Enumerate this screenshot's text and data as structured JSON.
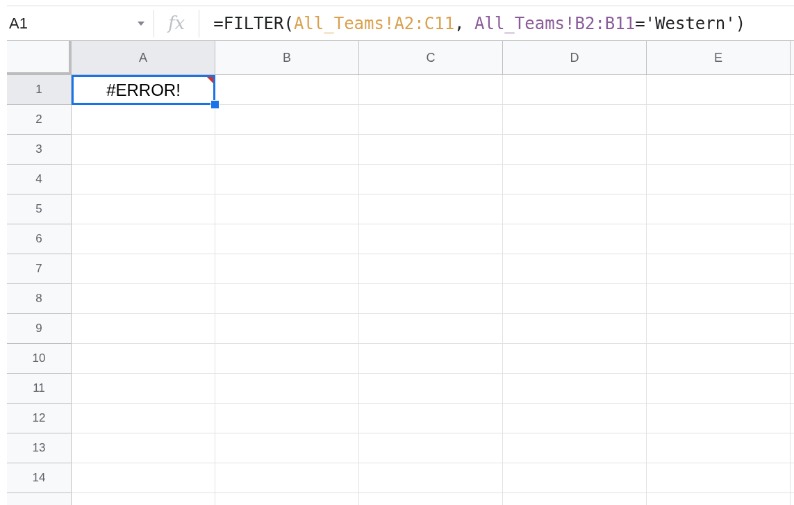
{
  "name_box": "A1",
  "formula_bar": {
    "icon_label": "fx",
    "parts": [
      {
        "text": "=FILTER(",
        "color": "#202124"
      },
      {
        "text": "All_Teams!A2:C11",
        "color": "#d9a14e"
      },
      {
        "text": ", ",
        "color": "#202124"
      },
      {
        "text": "All_Teams!B2:B11",
        "color": "#8a5b9a"
      },
      {
        "text": "='Western')",
        "color": "#202124"
      }
    ]
  },
  "columns": [
    {
      "label": "A",
      "selected": true
    },
    {
      "label": "B",
      "selected": false
    },
    {
      "label": "C",
      "selected": false
    },
    {
      "label": "D",
      "selected": false
    },
    {
      "label": "E",
      "selected": false
    }
  ],
  "rows": [
    {
      "label": "1",
      "selected": true,
      "cells": [
        {
          "text": "#ERROR!",
          "selected": true,
          "error": true
        }
      ]
    },
    {
      "label": "2",
      "selected": false
    },
    {
      "label": "3",
      "selected": false
    },
    {
      "label": "4",
      "selected": false
    },
    {
      "label": "5",
      "selected": false
    },
    {
      "label": "6",
      "selected": false
    },
    {
      "label": "7",
      "selected": false
    },
    {
      "label": "8",
      "selected": false
    },
    {
      "label": "9",
      "selected": false
    },
    {
      "label": "10",
      "selected": false
    },
    {
      "label": "11",
      "selected": false
    },
    {
      "label": "12",
      "selected": false
    },
    {
      "label": "13",
      "selected": false
    },
    {
      "label": "14",
      "selected": false
    }
  ]
}
